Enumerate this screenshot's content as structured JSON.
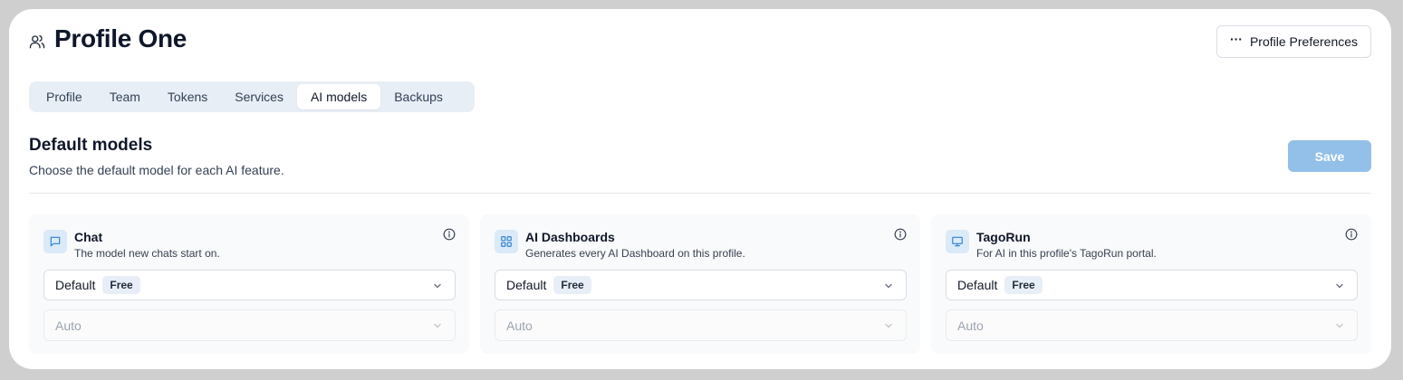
{
  "page": {
    "title": "Profile One",
    "icon": "users-icon"
  },
  "header": {
    "preferences_label": "Profile Preferences",
    "preferences_icon": "more-dots-icon"
  },
  "tabs": [
    {
      "label": "Profile",
      "active": false
    },
    {
      "label": "Team",
      "active": false
    },
    {
      "label": "Tokens",
      "active": false
    },
    {
      "label": "Services",
      "active": false
    },
    {
      "label": "AI models",
      "active": true
    },
    {
      "label": "Backups",
      "active": false
    }
  ],
  "section": {
    "title": "Default models",
    "subtitle": "Choose the default model for each AI feature.",
    "save_label": "Save"
  },
  "cards": [
    {
      "icon": "chat-icon",
      "title": "Chat",
      "description": "The model new chats start on.",
      "model_value": "Default",
      "model_badge": "Free",
      "secondary_value": "Auto"
    },
    {
      "icon": "dashboard-icon",
      "title": "AI Dashboards",
      "description": "Generates every AI Dashboard on this profile.",
      "model_value": "Default",
      "model_badge": "Free",
      "secondary_value": "Auto"
    },
    {
      "icon": "monitor-icon",
      "title": "TagoRun",
      "description": "For AI in this profile's TagoRun portal.",
      "model_value": "Default",
      "model_badge": "Free",
      "secondary_value": "Auto"
    }
  ],
  "colors": {
    "accent": "#93c0e8",
    "tabs_bg": "#e8eef5",
    "icon_bg": "#dbeaf8",
    "icon_fg": "#2f80d1"
  }
}
